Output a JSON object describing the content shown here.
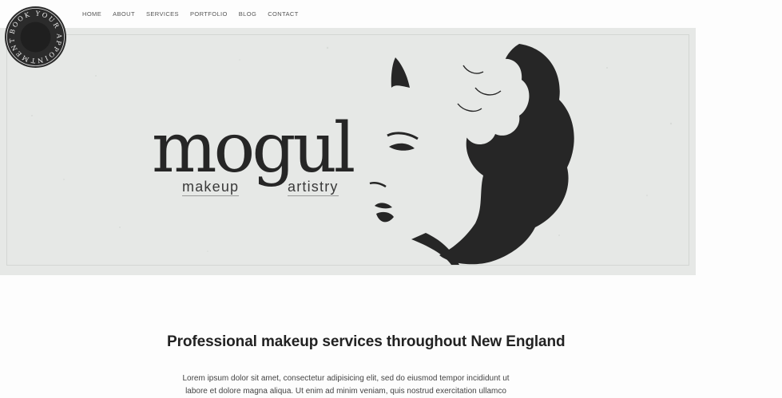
{
  "nav": {
    "items": [
      "HOME",
      "ABOUT",
      "SERVICES",
      "PORTFOLIO",
      "BLOG",
      "CONTACT"
    ]
  },
  "badge": {
    "text": "BOOK YOUR APPOINTMENT",
    "icon": "circular-badge-icon"
  },
  "hero": {
    "logo_main": "mogul",
    "logo_sub_left": "makeup",
    "logo_sub_right": "artistry",
    "illustration": "woman-silhouette-illustration"
  },
  "content": {
    "headline": "Professional makeup services throughout New England",
    "body": "Lorem ipsum dolor sit amet, consectetur adipisicing elit, sed do eiusmod tempor incididunt ut labore et dolore magna aliqua. Ut enim ad minim veniam, quis nostrud exercitation ullamco"
  },
  "colors": {
    "background": "#fdfdfd",
    "hero_bg": "#e6e8e6",
    "ink": "#262626"
  }
}
